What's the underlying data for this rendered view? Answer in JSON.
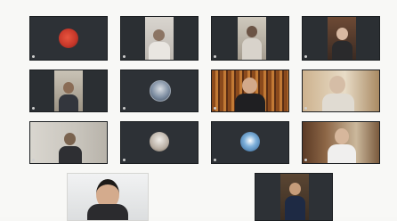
{
  "meeting": {
    "participants": [
      {
        "name": "",
        "type": "avatar"
      },
      {
        "name": "",
        "type": "video"
      },
      {
        "name": "",
        "type": "video"
      },
      {
        "name": "",
        "type": "video"
      },
      {
        "name": "",
        "type": "video"
      },
      {
        "name": "",
        "type": "avatar"
      },
      {
        "name": "",
        "type": "video"
      },
      {
        "name": "",
        "type": "video"
      },
      {
        "name": "",
        "type": "video"
      },
      {
        "name": "",
        "type": "avatar"
      },
      {
        "name": "",
        "type": "avatar"
      },
      {
        "name": "",
        "type": "video"
      },
      {
        "name": "",
        "type": "video"
      },
      {
        "name": "",
        "type": "video"
      }
    ]
  },
  "colors": {
    "tile_bg": "#2d3136",
    "background": "#f8f8f6",
    "avatar_red": "#c8382a",
    "avatar_blue": "#4e7fb0",
    "bookshelf_orange": "#a5652a"
  }
}
